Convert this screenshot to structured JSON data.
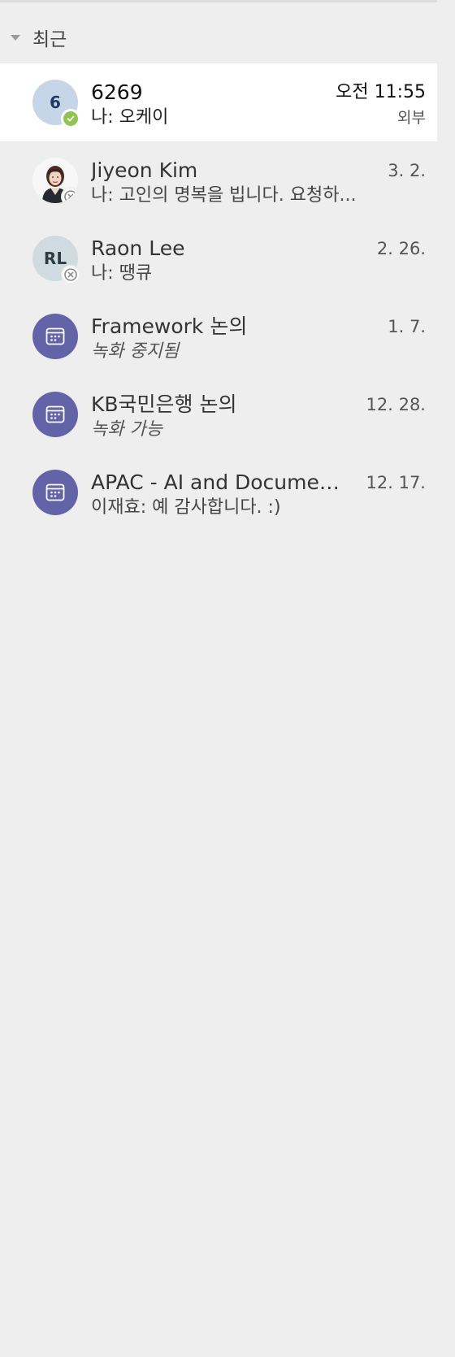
{
  "section": {
    "title": "최근"
  },
  "chats": [
    {
      "name": "6269",
      "time": "오전 11:55",
      "preview": "나: 오케이",
      "tag": "외부",
      "avatar_initials": "6",
      "status": "available"
    },
    {
      "name": "Jiyeon Kim",
      "time": "3. 2.",
      "preview": "나: 고인의 명복을 빕니다. 요청하...",
      "avatar": "photo",
      "status": "offline"
    },
    {
      "name": "Raon Lee",
      "time": "2. 26.",
      "preview": "나: 땡큐",
      "avatar_initials": "RL",
      "status": "offline"
    },
    {
      "name": "Framework 논의",
      "time": "1. 7.",
      "preview": "녹화 중지됨",
      "avatar": "calendar-icon"
    },
    {
      "name": "KB국민은행 논의",
      "time": "12. 28.",
      "preview": "녹화 가능",
      "avatar": "calendar-icon"
    },
    {
      "name": "APAC - AI and Documen...",
      "time": "12. 17.",
      "preview": "이재효: 예 감사합니다. :)",
      "avatar": "calendar-icon"
    }
  ],
  "colors": {
    "background": "#eeeeee",
    "active_row": "#ffffff",
    "meeting_avatar": "#6264a7",
    "available_status": "#92c353"
  }
}
